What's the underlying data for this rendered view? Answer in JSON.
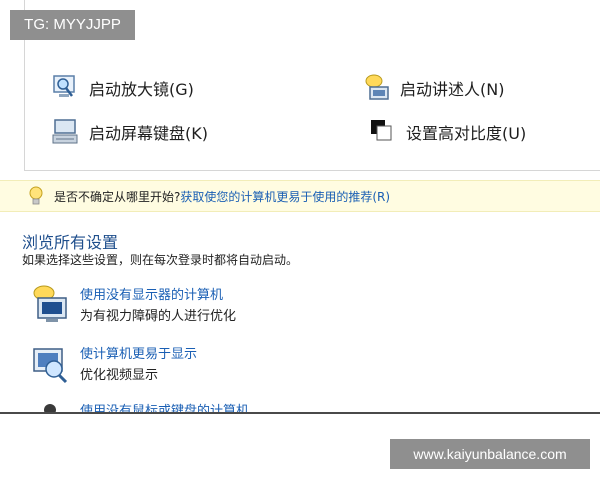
{
  "watermarks": {
    "top_left": "TG: MYYJJPP",
    "bottom_right": "www.kaiyunbalance.com"
  },
  "quick_access": {
    "items": [
      {
        "label": "启动放大镜(G)",
        "icon": "magnifier-icon"
      },
      {
        "label": "启动讲述人(N)",
        "icon": "narrator-icon"
      },
      {
        "label": "启动屏幕键盘(K)",
        "icon": "on-screen-keyboard-icon"
      },
      {
        "label": "设置高对比度(U)",
        "icon": "high-contrast-icon"
      }
    ]
  },
  "tip": {
    "text": "是否不确定从哪里开始?",
    "link": "获取使您的计算机更易于使用的推荐(R)",
    "icon": "lightbulb-icon"
  },
  "browse": {
    "title": "浏览所有设置",
    "description": "如果选择这些设置，则在每次登录时都将自动启动。"
  },
  "settings": [
    {
      "title": "使用没有显示器的计算机",
      "description": "为有视力障碍的人进行优化",
      "icon": "no-display-computer-icon"
    },
    {
      "title": "使计算机更易于显示",
      "description": "优化视频显示",
      "icon": "easier-display-icon"
    },
    {
      "title": "使用没有鼠标或键盘的计算机",
      "description": "",
      "icon": "no-mouse-keyboard-icon"
    }
  ],
  "colors": {
    "link_blue": "#1a5fb4",
    "heading_blue": "#1e4e8c",
    "tip_background": "#fffce1"
  }
}
